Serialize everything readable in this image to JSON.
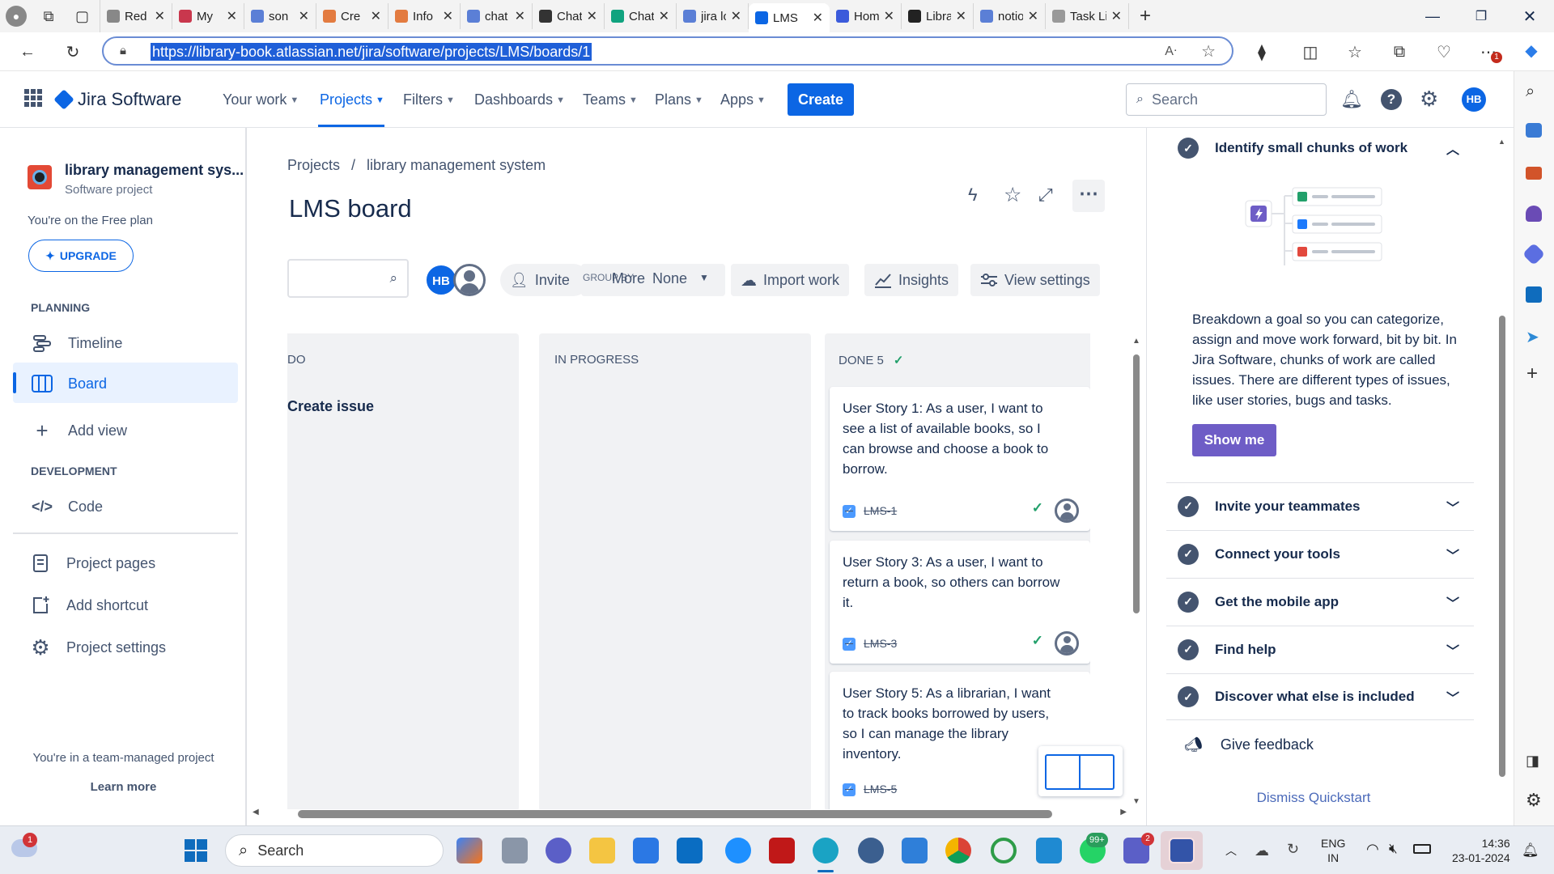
{
  "browser": {
    "tabs": [
      {
        "label": "Red",
        "color": "#888888"
      },
      {
        "label": "My",
        "color": "#c9374d"
      },
      {
        "label": "son",
        "color": "#5b7fd6"
      },
      {
        "label": "Cre",
        "color": "#e37b40"
      },
      {
        "label": "Info",
        "color": "#e37b40"
      },
      {
        "label": "chat",
        "color": "#5b7fd6"
      },
      {
        "label": "ChatGPT",
        "color": "#333333"
      },
      {
        "label": "ChatGPT",
        "color": "#10a37f"
      },
      {
        "label": "jira login",
        "color": "#5b7fd6"
      },
      {
        "label": "LMS",
        "color": "#0c66e4"
      },
      {
        "label": "Home —",
        "color": "#3b5bdb"
      },
      {
        "label": "Library-M",
        "color": "#222222"
      },
      {
        "label": "notion -",
        "color": "#5b7fd6"
      },
      {
        "label": "Task List",
        "color": "#999999"
      }
    ],
    "url": "https://library-book.atlassian.net/jira/software/projects/LMS/boards/1",
    "notif_count": "1"
  },
  "header": {
    "product": "Jira Software",
    "nav": [
      "Your work",
      "Projects",
      "Filters",
      "Dashboards",
      "Teams",
      "Plans",
      "Apps"
    ],
    "create": "Create",
    "search_placeholder": "Search",
    "avatar": "HB"
  },
  "sidebar": {
    "project_name": "library management sys...",
    "project_type": "Software project",
    "plan_text": "You're on the Free plan",
    "upgrade": "UPGRADE",
    "planning_heading": "PLANNING",
    "timeline": "Timeline",
    "board": "Board",
    "add_view": "Add view",
    "development_heading": "DEVELOPMENT",
    "code": "Code",
    "project_pages": "Project pages",
    "add_shortcut": "Add shortcut",
    "project_settings": "Project settings",
    "team_text": "You're in a team-managed project",
    "learn_more": "Learn more"
  },
  "board": {
    "breadcrumb_projects": "Projects",
    "breadcrumb_sep": "/",
    "breadcrumb_project": "library management system",
    "title": "LMS board",
    "avatar": "HB",
    "invite": "Invite",
    "group_by_label": "GROUP BY",
    "more": "More",
    "group_by_value": "None",
    "import_work": "Import work",
    "insights": "Insights",
    "view_settings": "View settings",
    "columns": {
      "todo": "DO",
      "in_progress": "IN PROGRESS",
      "done": "DONE 5"
    },
    "create_issue": "Create issue",
    "cards": [
      {
        "text": "User Story 1: As a user, I want to see a list of available books, so I can browse and choose a book to borrow.",
        "key": "LMS-1"
      },
      {
        "text": "User Story 3: As a user, I want to return a book, so others can borrow it.",
        "key": "LMS-3"
      },
      {
        "text": "User Story 5: As a librarian, I want to track books borrowed by users, so I can manage the library inventory.",
        "key": "LMS-5"
      }
    ]
  },
  "quickstart": {
    "open_item": "Identify small chunks of work",
    "description": "Breakdown a goal so you can categorize, assign and move work forward, bit by bit. In Jira Software, chunks of work are called issues. There are different types of issues, like user stories, bugs and tasks.",
    "show_me": "Show me",
    "items": [
      "Invite your teammates",
      "Connect your tools",
      "Get the mobile app",
      "Find help",
      "Discover what else is included"
    ],
    "give_feedback": "Give feedback",
    "dismiss": "Dismiss Quickstart"
  },
  "taskbar": {
    "search": "Search",
    "lang1": "ENG",
    "lang2": "IN",
    "time": "14:36",
    "date": "23-01-2024",
    "weather_badge": "1",
    "whatsapp_badge": "99+",
    "teams_badge": "2"
  }
}
